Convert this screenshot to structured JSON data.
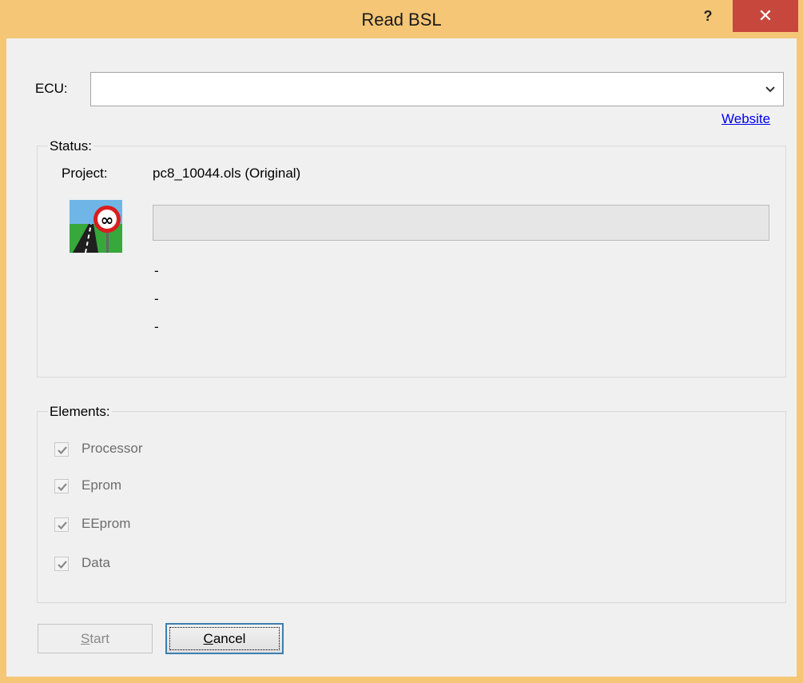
{
  "window": {
    "title": "Read BSL",
    "help_label": "?",
    "close_label": "✕"
  },
  "ecu": {
    "label": "ECU:",
    "value": "",
    "website_link": "Website"
  },
  "status": {
    "group_title": "Status:",
    "project_label": "Project:",
    "project_value": "pc8_10044.ols (Original)",
    "progress": 0,
    "lines": [
      "-",
      "-",
      "-"
    ]
  },
  "elements": {
    "group_title": "Elements:",
    "items": [
      {
        "label": "Processor",
        "checked": true,
        "enabled": false
      },
      {
        "label": "Eprom",
        "checked": true,
        "enabled": false
      },
      {
        "label": "EEprom",
        "checked": true,
        "enabled": false
      },
      {
        "label": "Data",
        "checked": true,
        "enabled": false
      }
    ]
  },
  "buttons": {
    "start": {
      "mnemonic": "S",
      "rest": "tart"
    },
    "cancel": {
      "mnemonic": "C",
      "rest": "ancel"
    }
  },
  "icons": {
    "logo": "winols-road-sign-icon",
    "chevron": "chevron-down-icon",
    "check": "checkmark-icon"
  }
}
